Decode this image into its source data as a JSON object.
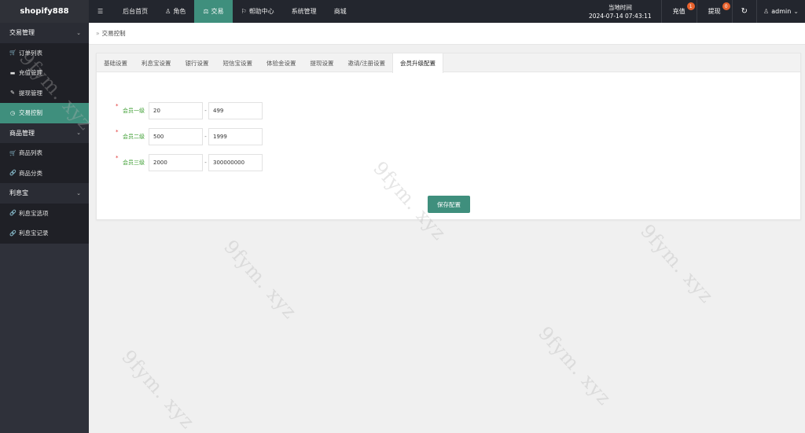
{
  "brand": "shopify888",
  "top_nav": [
    {
      "icon": "☰",
      "icon_name": "menu-icon",
      "label": ""
    },
    {
      "icon": "",
      "icon_name": "",
      "label": "后台首页"
    },
    {
      "icon": "♙",
      "icon_name": "user-icon",
      "label": "角色"
    },
    {
      "icon": "⚖",
      "icon_name": "exchange-icon",
      "label": "交易"
    },
    {
      "icon": "⚐",
      "icon_name": "flag-icon",
      "label": "帮助中心"
    },
    {
      "icon": "",
      "icon_name": "",
      "label": "系统管理"
    },
    {
      "icon": "",
      "icon_name": "",
      "label": "商城"
    }
  ],
  "active_top_nav": 3,
  "clock": {
    "label": "当地时间",
    "value": "2024-07-14 07:43:11"
  },
  "top_right": {
    "recharge": {
      "label": "充值",
      "badge": "1"
    },
    "withdraw": {
      "label": "提现",
      "badge": "0"
    },
    "refresh_icon": "↻",
    "user": {
      "icon": "♙",
      "name": "admin",
      "chevron": "⌄"
    }
  },
  "sidebar": [
    {
      "type": "group",
      "label": "交易管理",
      "chevron": "⌄"
    },
    {
      "type": "item",
      "icon": "🛒",
      "icon_name": "cart-icon",
      "label": "订单列表"
    },
    {
      "type": "item",
      "icon": "▬",
      "icon_name": "card-icon",
      "label": "充值管理"
    },
    {
      "type": "item",
      "icon": "✎",
      "icon_name": "hammer-icon",
      "label": "提现管理"
    },
    {
      "type": "item",
      "icon": "◷",
      "icon_name": "dashboard-icon",
      "label": "交易控制",
      "active": true
    },
    {
      "type": "group",
      "label": "商品管理",
      "chevron": "⌄"
    },
    {
      "type": "item",
      "icon": "🛒",
      "icon_name": "cart-icon",
      "label": "商品列表"
    },
    {
      "type": "item",
      "icon": "🔗",
      "icon_name": "link-icon",
      "label": "商品分类"
    },
    {
      "type": "group",
      "label": "利息宝",
      "chevron": "⌄"
    },
    {
      "type": "item",
      "icon": "🔗",
      "icon_name": "link-icon",
      "label": "利息宝选项"
    },
    {
      "type": "item",
      "icon": "🔗",
      "icon_name": "link-icon",
      "label": "利息宝记录"
    }
  ],
  "breadcrumb": {
    "arrow": "»",
    "label": "交易控制"
  },
  "tabs": [
    "基础设置",
    "利息宝设置",
    "银行设置",
    "短信宝设置",
    "体验金设置",
    "提现设置",
    "邀请/注册设置",
    "会员升级配置"
  ],
  "active_tab": 7,
  "form": {
    "rows": [
      {
        "label": "会员一级",
        "min": "20",
        "max": "499"
      },
      {
        "label": "会员二级",
        "min": "500",
        "max": "1999"
      },
      {
        "label": "会员三级",
        "min": "2000",
        "max": "300000000"
      }
    ],
    "required_mark": "*",
    "range_sep": "-"
  },
  "save_label": "保存配置",
  "watermark": "9fym. xyz",
  "colors": {
    "accent": "#3f8f7d",
    "header_bg": "#23262e",
    "sidebar_bg": "#2f313a",
    "label_green": "#3f9f34",
    "badge": "#e8612c"
  }
}
